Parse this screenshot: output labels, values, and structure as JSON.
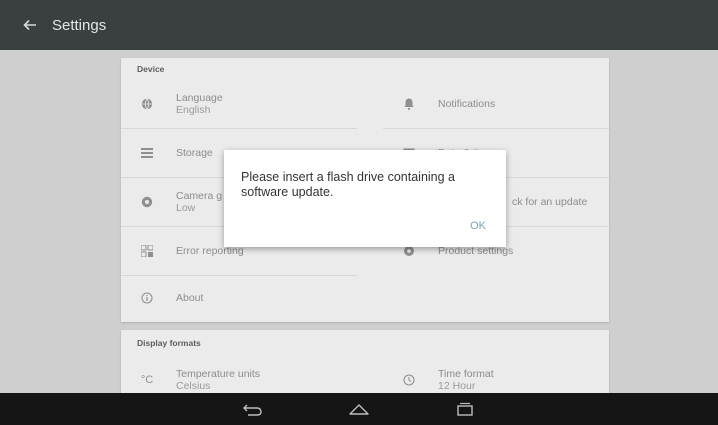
{
  "appbar": {
    "title": "Settings",
    "back_icon": "arrow-left-icon"
  },
  "device": {
    "header": "Device",
    "items_left": [
      {
        "icon": "globe-icon",
        "title": "Language",
        "subtitle": "English"
      },
      {
        "icon": "storage-icon",
        "title": "Storage",
        "subtitle": ""
      },
      {
        "icon": "camera-icon",
        "title": "Camera g",
        "subtitle": "Low"
      },
      {
        "icon": "bug-report-icon",
        "title": "Error reporting",
        "subtitle": ""
      },
      {
        "icon": "info-icon",
        "title": "About",
        "subtitle": ""
      }
    ],
    "items_right": [
      {
        "icon": "bell-icon",
        "title": "Notifications",
        "subtitle": ""
      },
      {
        "icon": "calendar-icon",
        "title": "Date & time",
        "subtitle": ""
      },
      {
        "icon": "update-icon",
        "title": "ck for an update",
        "subtitle": ""
      },
      {
        "icon": "gear-icon",
        "title": "Product settings",
        "subtitle": ""
      }
    ]
  },
  "display": {
    "header": "Display formats",
    "left": {
      "icon": "celsius-icon",
      "icon_text": "°C",
      "title": "Temperature units",
      "subtitle": "Celsius"
    },
    "right": {
      "icon": "clock-icon",
      "title": "Time format",
      "subtitle": "12 Hour"
    }
  },
  "dialog": {
    "message": "Please insert a flash drive containing a software update.",
    "ok_label": "OK"
  },
  "navbar": {
    "back_icon": "nav-back-icon",
    "home_icon": "nav-home-icon",
    "recents_icon": "nav-recents-icon"
  },
  "colors": {
    "appbar": "#3a3f41",
    "background": "#cfcfcf",
    "card": "#ebebeb",
    "accent": "#7aa2b6",
    "navbar": "#151515"
  }
}
